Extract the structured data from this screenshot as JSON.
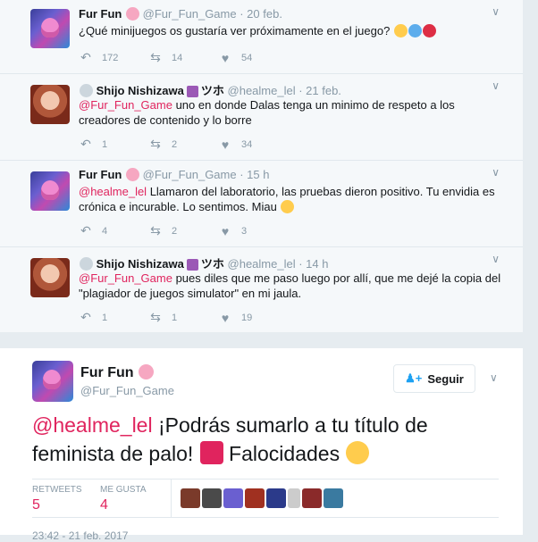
{
  "tweets": [
    {
      "name": "Fur Fun",
      "handle": "@Fur_Fun_Game",
      "time": "· 20 feb.",
      "text": "¿Qué minijuegos os gustaría ver próximamente en el juego?",
      "mention": "",
      "replies": "172",
      "retweets": "14",
      "likes": "54"
    },
    {
      "name": "Shijo Nishizawa",
      "name_suffix": "ツホ",
      "handle": "@healme_lel",
      "time": "· 21 feb.",
      "mention": "@Fur_Fun_Game",
      "text": " uno en donde Dalas tenga un minimo de respeto a los creadores de contenido y lo borre",
      "replies": "1",
      "retweets": "2",
      "likes": "34"
    },
    {
      "name": "Fur Fun",
      "handle": "@Fur_Fun_Game",
      "time": "· 15 h",
      "mention": "@healme_lel",
      "text": " Llamaron del laboratorio, las pruebas dieron positivo. Tu envidia es crónica e incurable. Lo sentimos. Miau",
      "replies": "4",
      "retweets": "2",
      "likes": "3"
    },
    {
      "name": "Shijo Nishizawa",
      "name_suffix": "ツホ",
      "handle": "@healme_lel",
      "time": "· 14 h",
      "mention": "@Fur_Fun_Game",
      "text": " pues diles que me paso luego por allí, que me dejé la copia del \"plagiador de juegos simulator\" en mi jaula.",
      "replies": "1",
      "retweets": "1",
      "likes": "19"
    }
  ],
  "main_tweet": {
    "name": "Fur Fun",
    "handle": "@Fur_Fun_Game",
    "follow_label": "Seguir",
    "mention": "@healme_lel",
    "text_part1": " ¡Podrás sumarlo a tu título de feminista de palo! ",
    "text_part2": " Falocidades ",
    "retweets_label": "RETWEETS",
    "retweets_count": "5",
    "likes_label": "ME GUSTA",
    "likes_count": "4",
    "timestamp": "23:42 - 21 feb. 2017"
  },
  "colors": {
    "accent": "#e0245e",
    "muted": "#8899a6",
    "border": "#e1e8ed"
  },
  "icons": [
    "reply-icon",
    "retweet-icon",
    "heart-icon",
    "chevron-down-icon",
    "follow-user-icon"
  ]
}
